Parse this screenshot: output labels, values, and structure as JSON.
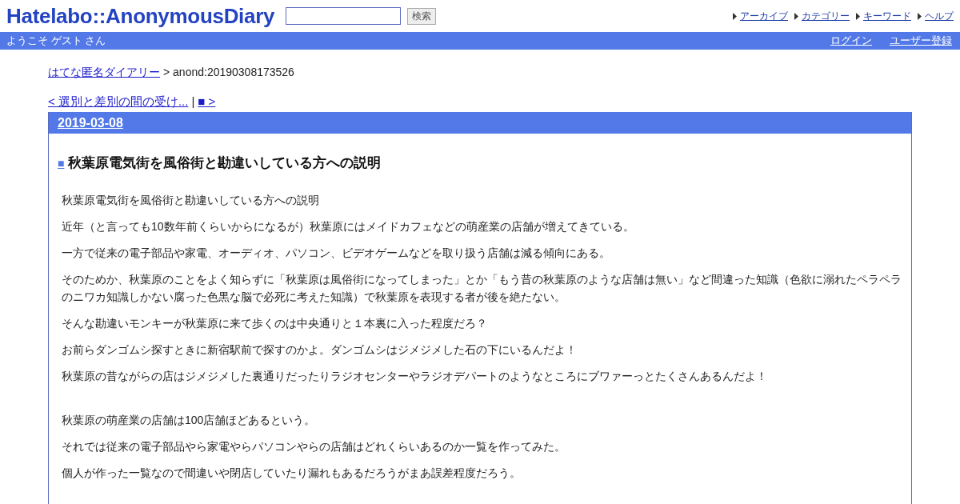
{
  "header": {
    "logo": "Hatelabo::AnonymousDiary",
    "search": {
      "button": "検索"
    },
    "nav_links": [
      "アーカイブ",
      "カテゴリー",
      "キーワード",
      "ヘルプ"
    ],
    "welcome": "ようこそ ゲスト さん",
    "account_links": [
      "ログイン",
      "ユーザー登録"
    ]
  },
  "breadcrumb": {
    "home": "はてな匿名ダイアリー",
    "current": "> anond:20190308173526"
  },
  "pager": {
    "previous": "< 選別と差別の間の受け...",
    "separator": "|",
    "next": "■ >"
  },
  "entry": {
    "date": "2019-03-08",
    "title_mark": "■",
    "title": "秋葉原電気街を風俗街と勘違いしている方への説明",
    "paragraphs": [
      {
        "kind": "text",
        "text": "秋葉原電気街を風俗街と勘違いしている方への説明"
      },
      {
        "kind": "text",
        "text": "近年（と言っても10数年前くらいからになるが）秋葉原にはメイドカフェなどの萌産業の店舗が増えてきている。"
      },
      {
        "kind": "text",
        "text": "一方で従来の電子部品や家電、オーディオ、パソコン、ビデオゲームなどを取り扱う店舗は減る傾向にある。"
      },
      {
        "kind": "text",
        "text": "そのためか、秋葉原のことをよく知らずに「秋葉原は風俗街になってしまった」とか「もう昔の秋葉原のような店舗は無い」など間違った知識（色欲に溺れたペラペラのニワカ知識しかない腐った色黒な脳で必死に考えた知識）で秋葉原を表現する者が後を絶たない。"
      },
      {
        "kind": "text",
        "text": "そんな勘違いモンキーが秋葉原に来て歩くのは中央通りと１本裏に入った程度だろ？"
      },
      {
        "kind": "text",
        "text": "お前らダンゴムシ探すときに新宿駅前で探すのかよ。ダンゴムシはジメジメした石の下にいるんだよ！"
      },
      {
        "kind": "text",
        "text": "秋葉原の昔ながらの店はジメジメした裏通りだったりラジオセンターやラジオデパートのようなところにブワァーっとたくさんあるんだよ！"
      },
      {
        "kind": "blank"
      },
      {
        "kind": "text",
        "text": "秋葉原の萌産業の店舗は100店舗ほどあるという。"
      },
      {
        "kind": "text",
        "text": "それでは従来の電子部品やら家電やらパソコンやらの店舗はどれくらいあるのか一覧を作ってみた。"
      },
      {
        "kind": "text",
        "text": "個人が作った一覧なので間違いや閉店していたり漏れもあるだろうがまあ誤差程度だろう。"
      }
    ]
  }
}
